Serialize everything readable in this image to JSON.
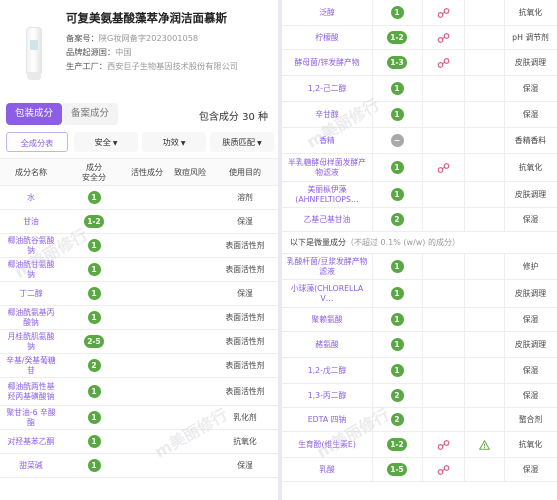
{
  "product": {
    "title": "可复美氨基酸藻萃净润洁面慕斯",
    "record_label": "备案号：",
    "record_value": "陕G妆网备字2023001058",
    "origin_label": "品牌起源国：",
    "origin_value": "中国",
    "factory_label": "生产工厂：",
    "factory_value": "西安巨子生物基因技术股份有限公司"
  },
  "tabs": [
    {
      "label": "包装成分",
      "active": true
    },
    {
      "label": "备案成分",
      "active": false
    }
  ],
  "count_text": "包含成分 30 种",
  "filters": [
    "全成分表",
    "安全",
    "功效",
    "肤质匹配"
  ],
  "headers": [
    "成分名称",
    "成分\n安全分",
    "活性成分",
    "致痘风险",
    "使用目的"
  ],
  "left_rows": [
    {
      "name": "水",
      "score": "1",
      "purpose": "溶剂",
      "h": 24
    },
    {
      "name": "甘油",
      "score": "1-2",
      "purpose": "保湿",
      "h": 24
    },
    {
      "name": "椰油酰谷氨酸钠",
      "score": "1",
      "purpose": "表面活性剂",
      "h": 24
    },
    {
      "name": "椰油酰甘氨酸钠",
      "score": "1",
      "purpose": "表面活性剂",
      "h": 24
    },
    {
      "name": "丁二醇",
      "score": "1",
      "purpose": "保湿",
      "h": 24
    },
    {
      "name": "椰油酰氨基丙酸钠",
      "score": "1",
      "purpose": "表面活性剂",
      "h": 24
    },
    {
      "name": "月桂酰肌氨酸钠",
      "score": "2-5",
      "purpose": "表面活性剂",
      "h": 24
    },
    {
      "name": "辛基/癸基葡糖苷",
      "score": "2",
      "purpose": "表面活性剂",
      "h": 24
    },
    {
      "name": "椰油酰两性基羟丙基磺酸钠",
      "score": "1",
      "purpose": "表面活性剂",
      "h": 28
    },
    {
      "name": "聚甘油-6 辛酸酯",
      "score": "1",
      "purpose": "乳化剂",
      "h": 24
    },
    {
      "name": "对羟基苯乙酮",
      "score": "1",
      "purpose": "抗氧化",
      "h": 24
    },
    {
      "name": "甜菜碱",
      "score": "1",
      "purpose": "保湿",
      "h": 24
    }
  ],
  "right_rows_top": [
    {
      "name": "泛醇",
      "score": "1",
      "active": true,
      "purpose": "抗氧化",
      "h": 26
    },
    {
      "name": "柠檬酸",
      "score": "1-2",
      "active": true,
      "purpose": "pH 调节剂",
      "h": 24
    },
    {
      "name": "酵母菌/锌发酵产物",
      "score": "1-3",
      "active": true,
      "purpose": "皮肤调理",
      "h": 26
    },
    {
      "name": "1,2-己二醇",
      "score": "1",
      "active": false,
      "purpose": "保湿",
      "h": 26
    },
    {
      "name": "辛甘醇",
      "score": "1",
      "active": false,
      "purpose": "保湿",
      "h": 26
    },
    {
      "name": "香精",
      "score": "−",
      "grey": true,
      "active": false,
      "purpose": "香精香料",
      "h": 26
    },
    {
      "name": "半乳糖酵母样菌发酵产物滤液",
      "score": "1",
      "active": true,
      "purpose": "抗氧化",
      "h": 28
    },
    {
      "name": "美丽枞伊藻(AHNFELTIOPS…",
      "score": "1",
      "active": false,
      "purpose": "皮肤调理",
      "h": 26
    },
    {
      "name": "乙基己基甘油",
      "score": "2",
      "active": false,
      "purpose": "保湿",
      "h": 24
    }
  ],
  "section_note": {
    "main": "以下是微量成分",
    "sub": "（不超过 0.1% (w/w) 的成分）"
  },
  "right_rows_bottom": [
    {
      "name": "乳酸杆菌/豆浆发酵产物滤液",
      "score": "1",
      "active": false,
      "risk": false,
      "purpose": "修护",
      "h": 26
    },
    {
      "name": "小球藻(CHLORELLA V…",
      "score": "1",
      "active": false,
      "risk": false,
      "purpose": "皮肤调理",
      "h": 28
    },
    {
      "name": "聚赖氨酸",
      "score": "1",
      "active": false,
      "risk": false,
      "purpose": "保湿",
      "h": 24
    },
    {
      "name": "赭氨酸",
      "score": "1",
      "active": false,
      "risk": false,
      "purpose": "皮肤调理",
      "h": 26
    },
    {
      "name": "1,2-戊二醇",
      "score": "1",
      "active": false,
      "risk": false,
      "purpose": "保湿",
      "h": 26
    },
    {
      "name": "1,3-丙二醇",
      "score": "2",
      "active": false,
      "risk": false,
      "purpose": "保湿",
      "h": 24
    },
    {
      "name": "EDTA 四钠",
      "score": "2",
      "active": false,
      "risk": false,
      "purpose": "螯合剂",
      "h": 24
    },
    {
      "name": "生育酚(维生素E)",
      "score": "1-2",
      "active": true,
      "risk": true,
      "purpose": "抗氧化",
      "h": 26
    },
    {
      "name": "乳酸",
      "score": "1-5",
      "active": true,
      "risk": false,
      "purpose": "保湿",
      "h": 24
    }
  ],
  "watermark": "m美丽修行"
}
